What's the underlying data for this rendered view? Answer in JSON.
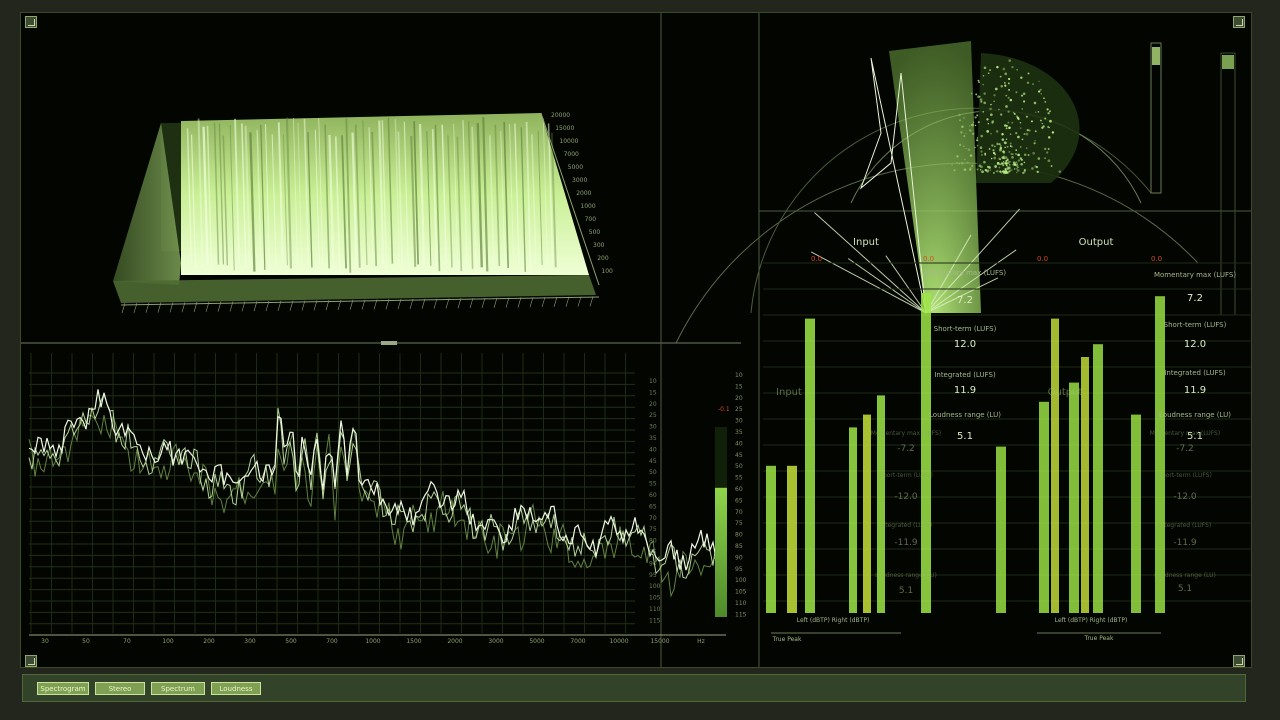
{
  "toolbar": {
    "buttons": [
      {
        "label": "Spectrogram"
      },
      {
        "label": "Stereo"
      },
      {
        "label": "Spectrum"
      },
      {
        "label": "Loudness"
      }
    ]
  },
  "spectrogram3d": {
    "freq_ticks": [
      "20000",
      "15000",
      "10000",
      "7000",
      "5000",
      "3000",
      "2000",
      "1000",
      "700",
      "500",
      "300",
      "200",
      "100"
    ]
  },
  "spectrum": {
    "x_ticks": [
      "30",
      "50",
      "70",
      "100",
      "200",
      "300",
      "500",
      "700",
      "1000",
      "1500",
      "2000",
      "3000",
      "5000",
      "7000",
      "10000",
      "15000",
      "Hz"
    ],
    "y_ticks": [
      "10",
      "15",
      "20",
      "25",
      "30",
      "35",
      "40",
      "45",
      "50",
      "55",
      "60",
      "65",
      "70",
      "75",
      "80",
      "85",
      "90",
      "95",
      "100",
      "105",
      "110",
      "115"
    ],
    "meter_tick_labels": [
      "10",
      "15",
      "20",
      "25",
      "30",
      "35",
      "40",
      "45",
      "50",
      "55",
      "60",
      "65",
      "70",
      "75",
      "80",
      "85",
      "90",
      "95",
      "100",
      "105",
      "110",
      "115"
    ],
    "meter_peak": "-0.1",
    "meter_level": 0.68
  },
  "loudness": {
    "input": {
      "title": "Input",
      "peaks": [
        "0.0",
        "0.0"
      ],
      "channels_label": "Left (dBTP)  Right (dBTP)",
      "momentary_label": "Momentary max (LUFS)",
      "momentary_value": "7.2",
      "shortterm_label": "Short-term (LUFS)",
      "shortterm_value": "12.0",
      "integrated_label": "Integrated (LUFS)",
      "integrated_value": "11.9",
      "range_label": "Loudness range (LU)",
      "range_value": "5.1",
      "true_peak_label": "True Peak",
      "bar_levels": [
        0.46,
        0.46,
        0.92,
        0.58,
        0.62,
        0.68,
        1.0
      ]
    },
    "output": {
      "title": "Output",
      "peaks": [
        "0.0",
        "0.0"
      ],
      "channels_label": "Left (dBTP)  Right (dBTP)",
      "momentary_label": "Momentary max (LUFS)",
      "momentary_value": "7.2",
      "shortterm_label": "Short-term (LUFS)",
      "shortterm_value": "12.0",
      "integrated_label": "Integrated (LUFS)",
      "integrated_value": "11.9",
      "range_label": "Loudness range (LU)",
      "range_value": "5.1",
      "true_peak_label": "True Peak",
      "bar_levels": [
        0.52,
        0.66,
        0.92,
        0.72,
        0.8,
        0.84,
        0.62,
        0.99
      ]
    },
    "ghost": {
      "input_title": "Input",
      "output_title": "Output",
      "momentary_label": "Momentary max (LUFS)",
      "momentary_value": "-7.2",
      "shortterm_label": "Short-term (LUFS)",
      "shortterm_value": "-12.0",
      "integrated_label": "Integrated (LUFS)",
      "integrated_value": "-11.9",
      "range_label": "Loudness range (LU)",
      "range_value": "5.1"
    }
  },
  "colors": {
    "accent": "#8dd44a",
    "bar_bright": "#9ee646",
    "bar_yellow": "#c7e23a",
    "trace": "#e8f5d8",
    "grid": "#24331b"
  }
}
